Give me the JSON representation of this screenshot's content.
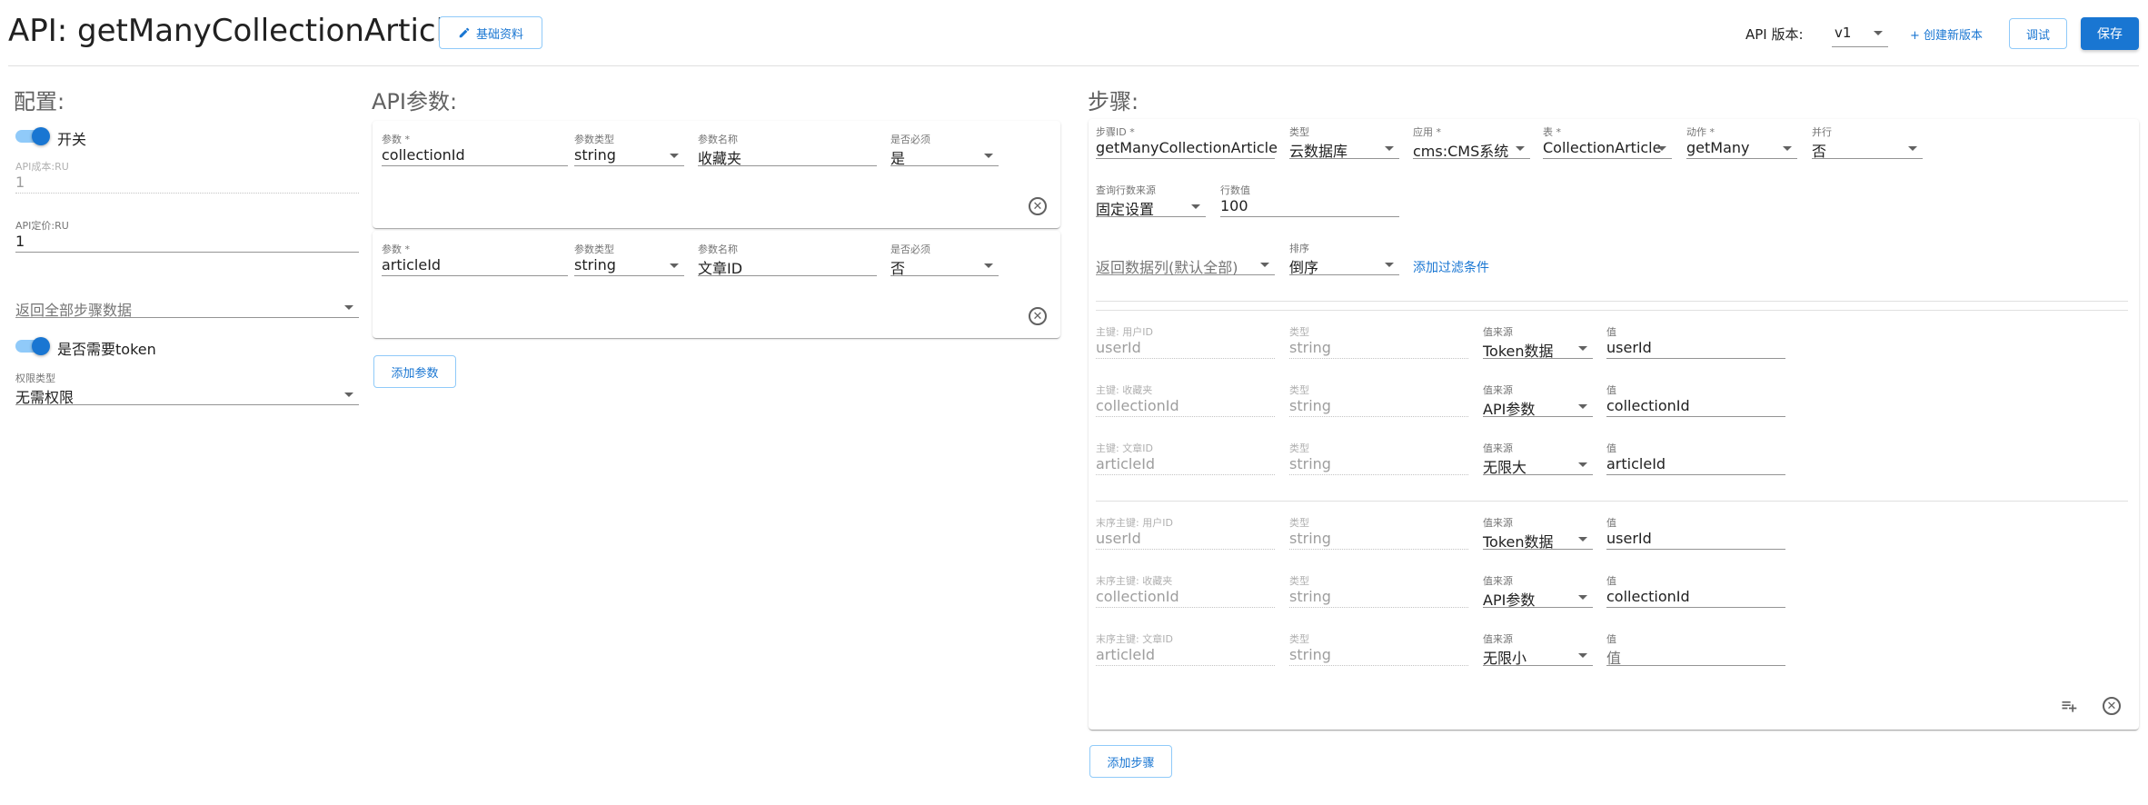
{
  "header": {
    "title": "API: getManyCollectionArticle",
    "basic_info_label": "基础资料",
    "version_label": "API 版本:",
    "version_value": "v1",
    "new_version_label": "+ 创建新版本",
    "debug_label": "调试",
    "save_label": "保存"
  },
  "config": {
    "title": "配置:",
    "switch_label": "开关",
    "cost_label": "API成本:RU",
    "cost_value": "1",
    "price_label": "API定价:RU",
    "price_value": "1",
    "return_all_placeholder": "返回全部步骤数据",
    "token_label": "是否需要token",
    "permission_label": "权限类型",
    "permission_value": "无需权限"
  },
  "params": {
    "title": "API参数:",
    "field_labels": {
      "name": "参数 *",
      "type": "参数类型",
      "display": "参数名称",
      "required": "是否必须"
    },
    "rows": [
      {
        "name": "collectionId",
        "type": "string",
        "display": "收藏夹",
        "required": "是"
      },
      {
        "name": "articleId",
        "type": "string",
        "display": "文章ID",
        "required": "否"
      }
    ],
    "add_label": "添加参数"
  },
  "steps": {
    "title": "步骤:",
    "step": {
      "id_label": "步骤ID *",
      "id_value": "getManyCollectionArticle",
      "type_label": "类型",
      "type_value": "云数据库",
      "app_label": "应用 *",
      "app_value": "cms:CMS系统",
      "table_label": "表 *",
      "table_value": "CollectionArticle",
      "action_label": "动作 *",
      "action_value": "getMany",
      "parallel_label": "并行",
      "parallel_value": "否",
      "rowsrc_label": "查询行数来源",
      "rowsrc_value": "固定设置",
      "rowcount_label": "行数值",
      "rowcount_value": "100",
      "return_cols_placeholder": "返回数据列(默认全部)",
      "sort_label": "排序",
      "sort_value": "倒序",
      "add_filter_label": "添加过滤条件",
      "col_labels": {
        "type": "类型",
        "source": "值来源",
        "value": "值"
      },
      "keys": [
        {
          "label": "主键: 用户ID",
          "name": "userId",
          "type": "string",
          "source": "Token数据",
          "value": "userId",
          "value_placeholder": false
        },
        {
          "label": "主键: 收藏夹",
          "name": "collectionId",
          "type": "string",
          "source": "API参数",
          "value": "collectionId",
          "value_placeholder": false
        },
        {
          "label": "主键: 文章ID",
          "name": "articleId",
          "type": "string",
          "source": "无限大",
          "value": "articleId",
          "value_placeholder": false
        }
      ],
      "sort_keys": [
        {
          "label": "末序主键: 用户ID",
          "name": "userId",
          "type": "string",
          "source": "Token数据",
          "value": "userId",
          "value_placeholder": false
        },
        {
          "label": "末序主键: 收藏夹",
          "name": "collectionId",
          "type": "string",
          "source": "API参数",
          "value": "collectionId",
          "value_placeholder": false
        },
        {
          "label": "末序主键: 文章ID",
          "name": "articleId",
          "type": "string",
          "source": "无限小",
          "value": "值",
          "value_placeholder": true
        }
      ]
    },
    "add_label": "添加步骤"
  },
  "colors": {
    "primary": "#1976d2",
    "primary_light": "#90caf9"
  },
  "icons": [
    "pencil-icon",
    "dropdown-arrow-icon",
    "close-circle-icon",
    "playlist-add-icon"
  ]
}
